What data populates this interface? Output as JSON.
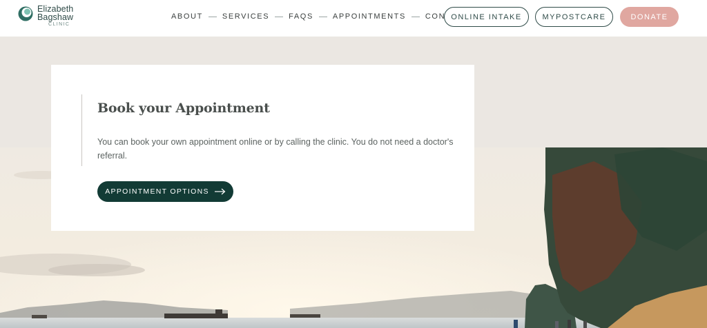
{
  "logo": {
    "line1": "Elizabeth",
    "line2": "Bagshaw",
    "line3": "CLINIC",
    "icon": "clinic-logo-icon"
  },
  "nav": {
    "items": [
      {
        "label": "ABOUT"
      },
      {
        "label": "SERVICES"
      },
      {
        "label": "FAQS"
      },
      {
        "label": "APPOINTMENTS"
      },
      {
        "label": "CONTACT US"
      }
    ]
  },
  "header_buttons": {
    "online_intake": "ONLINE INTAKE",
    "mypostcare": "MYPOSTCARE",
    "donate": "DONATE"
  },
  "card": {
    "title": "Book your Appointment",
    "text": "You can book your own appointment online or by calling the clinic. You do not need a doctor's referral.",
    "button_label": "APPOINTMENT OPTIONS",
    "button_icon": "arrow-right-icon"
  },
  "colors": {
    "brand_dark": "#123b35",
    "donate": "#e0a7a0",
    "hero_bg": "#ebe7e2"
  }
}
